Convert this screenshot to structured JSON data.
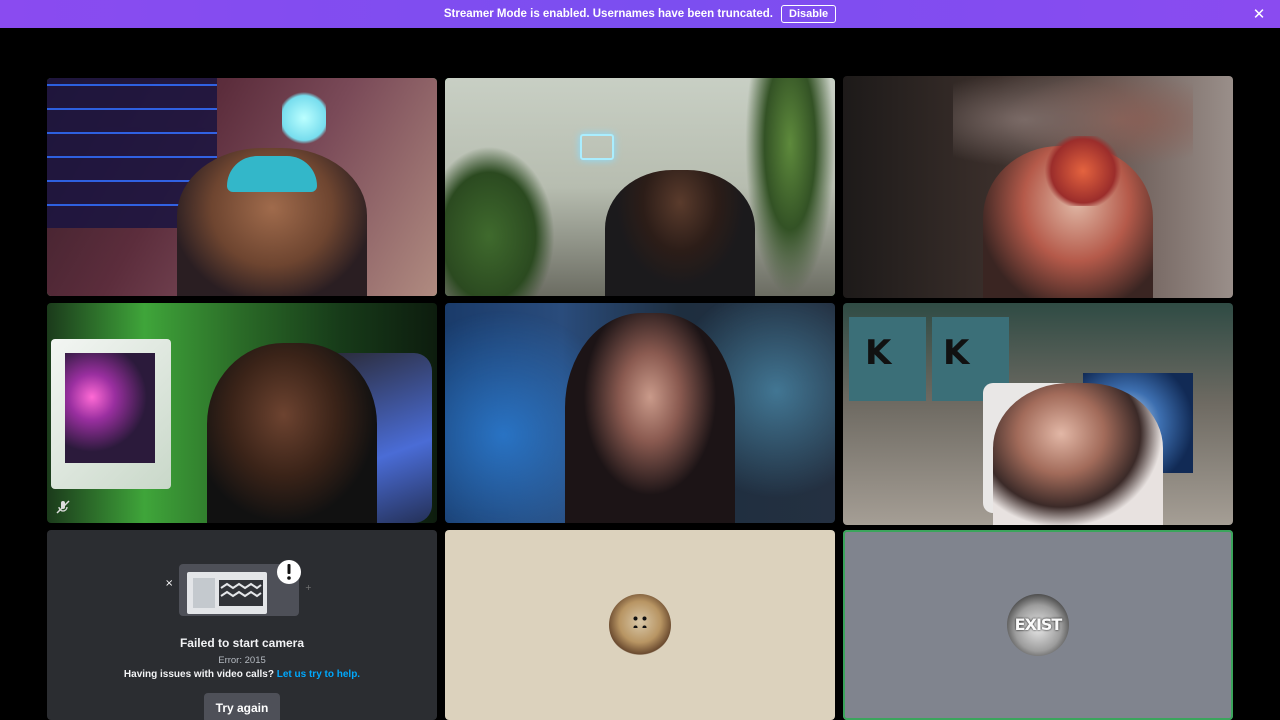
{
  "banner": {
    "message": "Streamer Mode is enabled. Usernames have been truncated.",
    "disable_label": "Disable",
    "close_icon": "close-icon",
    "color": "#7c4dff"
  },
  "tiles": [
    {
      "id": "t1",
      "type": "video",
      "speaking": true
    },
    {
      "id": "t2",
      "type": "video",
      "speaking": true
    },
    {
      "id": "t3",
      "type": "video",
      "speaking": false
    },
    {
      "id": "t4",
      "type": "video",
      "speaking": false,
      "muted_icon": "mic-muted-icon"
    },
    {
      "id": "t5",
      "type": "video",
      "speaking": false
    },
    {
      "id": "t6",
      "type": "video",
      "speaking": false
    },
    {
      "id": "t7",
      "type": "camera-error",
      "speaking": false
    },
    {
      "id": "t8",
      "type": "avatar",
      "speaking": false
    },
    {
      "id": "t9",
      "type": "avatar",
      "speaking": true
    }
  ],
  "camera_error": {
    "title": "Failed to start camera",
    "code": "Error: 2015",
    "help_text": "Having issues with video calls?",
    "help_link": "Let us try to help.",
    "retry_label": "Try again",
    "illustration_icon": "camera-error-illustration"
  },
  "avatar_exist": {
    "text": "EXIST"
  },
  "colors": {
    "speaking_ring": "#3ba55c",
    "link": "#00a8fc",
    "tile_bg": "#2b2d31"
  }
}
